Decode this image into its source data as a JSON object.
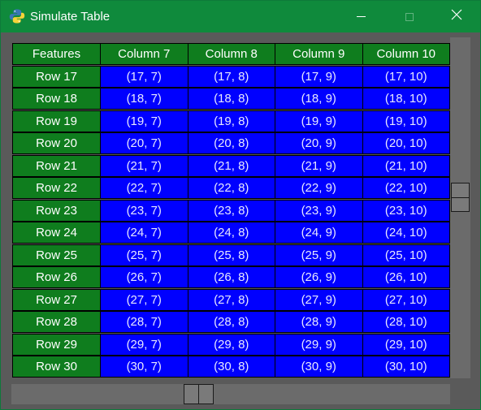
{
  "window": {
    "title": "Simulate Table",
    "icon": "python-icon"
  },
  "controls": {
    "minimize_icon": "minimize-icon",
    "maximize_icon": "maximize-icon",
    "close_icon": "close-icon",
    "close_glyph": "✕"
  },
  "colors": {
    "titlebar": "#0f8a3c",
    "header_bg": "#0f7d1e",
    "cell_bg": "#0000ff",
    "text": "#ffffff",
    "window_bg": "#5a5a5a"
  },
  "table": {
    "headers": [
      "Features",
      "Column 7",
      "Column 8",
      "Column 9",
      "Column 10"
    ],
    "rows": [
      {
        "label": "Row 17",
        "cells": [
          "(17, 7)",
          "(17, 8)",
          "(17, 9)",
          "(17, 10)"
        ]
      },
      {
        "label": "Row 18",
        "cells": [
          "(18, 7)",
          "(18, 8)",
          "(18, 9)",
          "(18, 10)"
        ]
      },
      {
        "label": "Row 19",
        "cells": [
          "(19, 7)",
          "(19, 8)",
          "(19, 9)",
          "(19, 10)"
        ]
      },
      {
        "label": "Row 20",
        "cells": [
          "(20, 7)",
          "(20, 8)",
          "(20, 9)",
          "(20, 10)"
        ]
      },
      {
        "label": "Row 21",
        "cells": [
          "(21, 7)",
          "(21, 8)",
          "(21, 9)",
          "(21, 10)"
        ]
      },
      {
        "label": "Row 22",
        "cells": [
          "(22, 7)",
          "(22, 8)",
          "(22, 9)",
          "(22, 10)"
        ]
      },
      {
        "label": "Row 23",
        "cells": [
          "(23, 7)",
          "(23, 8)",
          "(23, 9)",
          "(23, 10)"
        ]
      },
      {
        "label": "Row 24",
        "cells": [
          "(24, 7)",
          "(24, 8)",
          "(24, 9)",
          "(24, 10)"
        ]
      },
      {
        "label": "Row 25",
        "cells": [
          "(25, 7)",
          "(25, 8)",
          "(25, 9)",
          "(25, 10)"
        ]
      },
      {
        "label": "Row 26",
        "cells": [
          "(26, 7)",
          "(26, 8)",
          "(26, 9)",
          "(26, 10)"
        ]
      },
      {
        "label": "Row 27",
        "cells": [
          "(27, 7)",
          "(27, 8)",
          "(27, 9)",
          "(27, 10)"
        ]
      },
      {
        "label": "Row 28",
        "cells": [
          "(28, 7)",
          "(28, 8)",
          "(28, 9)",
          "(28, 10)"
        ]
      },
      {
        "label": "Row 29",
        "cells": [
          "(29, 7)",
          "(29, 8)",
          "(29, 9)",
          "(29, 10)"
        ]
      },
      {
        "label": "Row 30",
        "cells": [
          "(30, 7)",
          "(30, 8)",
          "(30, 9)",
          "(30, 10)"
        ]
      }
    ]
  },
  "scrollbars": {
    "vertical": {
      "position": 0.45
    },
    "horizontal": {
      "position": 0.42
    }
  }
}
